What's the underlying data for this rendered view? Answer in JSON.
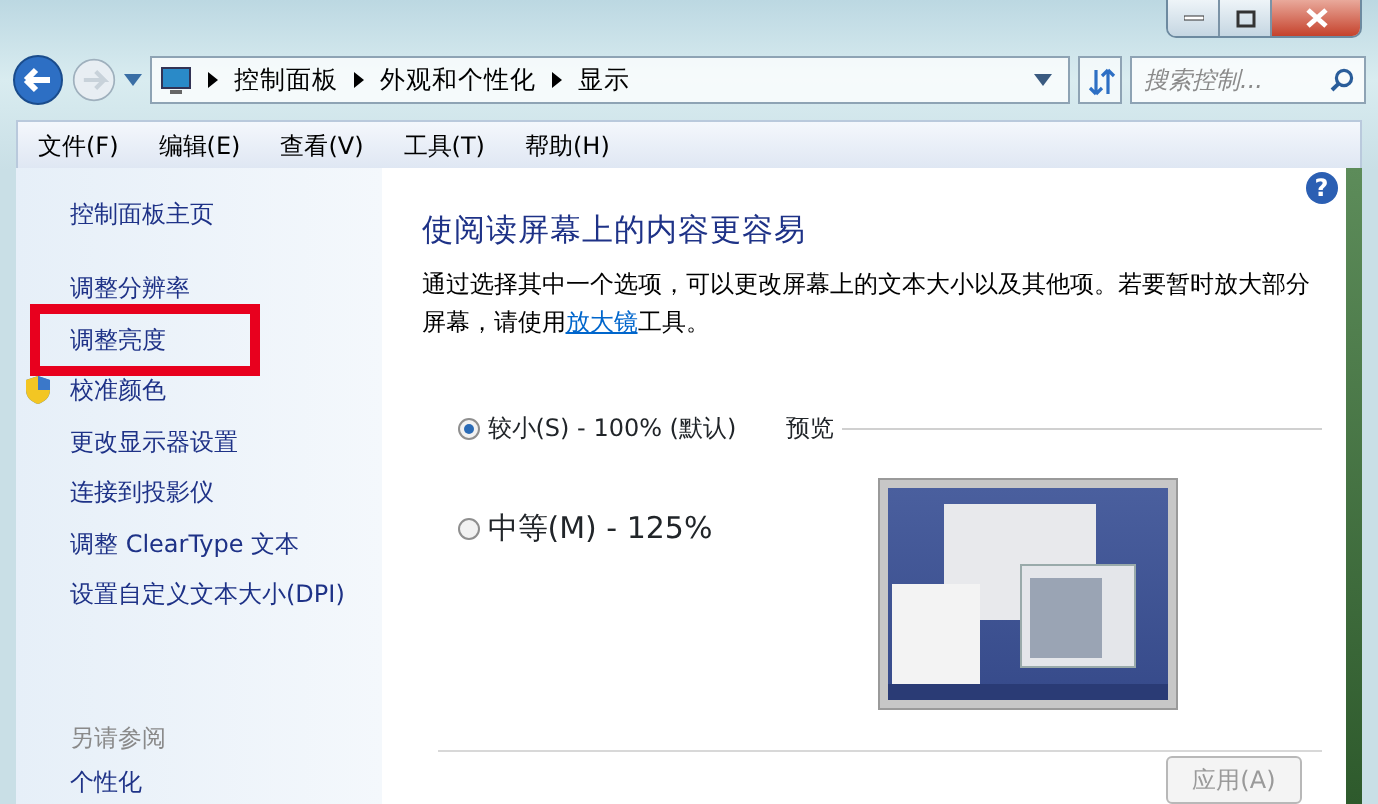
{
  "address_bar": {
    "breadcrumbs": [
      "控制面板",
      "外观和个性化",
      "显示"
    ]
  },
  "search": {
    "placeholder": "搜索控制..."
  },
  "menu": [
    "文件(F)",
    "编辑(E)",
    "查看(V)",
    "工具(T)",
    "帮助(H)"
  ],
  "sidebar": {
    "home": "控制面板主页",
    "items": [
      {
        "label": "调整分辨率",
        "kind": "plain",
        "highlighted": false
      },
      {
        "label": "调整亮度",
        "kind": "plain",
        "highlighted": true
      },
      {
        "label": "校准颜色",
        "kind": "shield",
        "highlighted": false
      },
      {
        "label": "更改显示器设置",
        "kind": "plain",
        "highlighted": false
      },
      {
        "label": "连接到投影仪",
        "kind": "plain",
        "highlighted": false
      },
      {
        "label": "调整 ClearType 文本",
        "kind": "plain",
        "highlighted": false
      },
      {
        "label": "设置自定义文本大小(DPI)",
        "kind": "plain",
        "highlighted": false
      }
    ],
    "see_also": {
      "heading": "另请参阅",
      "items": [
        "个性化"
      ]
    }
  },
  "content": {
    "help": "?",
    "title": "使阅读屏幕上的内容更容易",
    "description_before": "通过选择其中一个选项，可以更改屏幕上的文本大小以及其他项。若要暂时放大部分屏幕，请使用",
    "description_link": "放大镜",
    "description_after": "工具。",
    "options": [
      {
        "label": "较小(S) - 100% (默认)",
        "selected": true
      },
      {
        "label": "中等(M) - 125%",
        "selected": false
      }
    ],
    "preview_label": "预览",
    "apply_button": {
      "label": "应用(A)",
      "disabled": true
    }
  }
}
